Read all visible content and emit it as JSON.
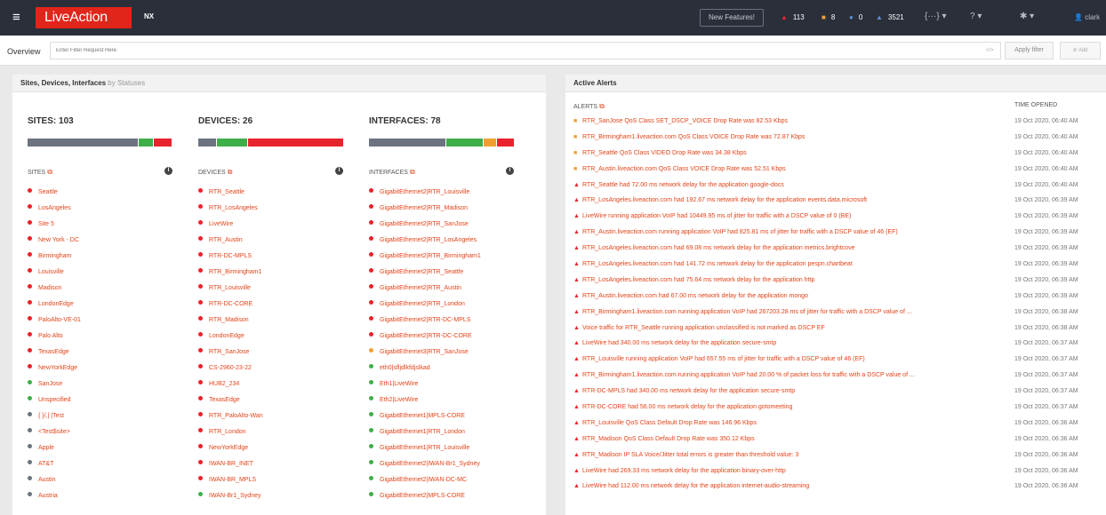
{
  "colors": {
    "topbar": "#2a2f3a",
    "brand_red": "#e2251a",
    "link_orange": "#e2441a",
    "status_red": "#e8232d",
    "status_green": "#3fae49",
    "status_gray": "#6c7380",
    "status_orange": "#f0a030"
  },
  "topbar": {
    "menu_icon": "hamburger-icon",
    "logo_text": "LiveAction",
    "product": "NX",
    "new_features": "New Features!",
    "counters": [
      {
        "icon": "triangle-icon",
        "glyph": "▲",
        "color": "#e8232d",
        "value": "113"
      },
      {
        "icon": "square-icon",
        "glyph": "■",
        "color": "#f0a030",
        "value": "8"
      },
      {
        "icon": "circle-icon",
        "glyph": "●",
        "color": "#5b8fd6",
        "value": "0"
      },
      {
        "icon": "bell-icon",
        "glyph": "🔔",
        "color": "#5b8fd6",
        "value": "3521"
      }
    ],
    "code_icon": "{···} ▾",
    "help_icon": "? ▾",
    "gear_icon": "✱ ▾",
    "user": "clark"
  },
  "filter": {
    "tab": "Overview",
    "placeholder": "Enter Filter Request Here",
    "clear": "</>",
    "apply": "Apply filter",
    "add": "Add"
  },
  "left_panel": {
    "title": "Sites, Devices, Interfaces",
    "subtitle": "by Statuses",
    "columns": [
      {
        "title": "SITES: 103",
        "header": "SITES",
        "bar": [
          {
            "status": "gray",
            "fraction": 0.76
          },
          {
            "status": "green",
            "fraction": 0.1
          },
          {
            "status": "red",
            "fraction": 0.12
          }
        ],
        "items": [
          {
            "label": "Seattle",
            "status": "red"
          },
          {
            "label": "LosAngeles",
            "status": "red"
          },
          {
            "label": "Site 5",
            "status": "red"
          },
          {
            "label": "New York - DC",
            "status": "red"
          },
          {
            "label": "Birmingham",
            "status": "red"
          },
          {
            "label": "Louisville",
            "status": "red"
          },
          {
            "label": "Madison",
            "status": "red"
          },
          {
            "label": "LondonEdge",
            "status": "red"
          },
          {
            "label": "PaloAlto-VE-01",
            "status": "red"
          },
          {
            "label": "Palo Alto",
            "status": "red"
          },
          {
            "label": "TexasEdge",
            "status": "red"
          },
          {
            "label": "NewYorkEdge",
            "status": "red"
          },
          {
            "label": "SanJose",
            "status": "green"
          },
          {
            "label": "Unspecified",
            "status": "green"
          },
          {
            "label": "{ }/,| |Test",
            "status": "gray"
          },
          {
            "label": "<Test$site>",
            "status": "gray"
          },
          {
            "label": "Apple",
            "status": "gray"
          },
          {
            "label": "AT&T",
            "status": "gray"
          },
          {
            "label": "Austin",
            "status": "gray"
          },
          {
            "label": "Austria",
            "status": "gray"
          }
        ]
      },
      {
        "title": "DEVICES: 26",
        "header": "DEVICES",
        "bar": [
          {
            "status": "gray",
            "fraction": 0.12
          },
          {
            "status": "green",
            "fraction": 0.21
          },
          {
            "status": "red",
            "fraction": 0.66
          }
        ],
        "items": [
          {
            "label": "RTR_Seattle",
            "status": "red"
          },
          {
            "label": "RTR_LosAngeles",
            "status": "red"
          },
          {
            "label": "LiveWire",
            "status": "red"
          },
          {
            "label": "RTR_Austin",
            "status": "red"
          },
          {
            "label": "RTR-DC-MPLS",
            "status": "red"
          },
          {
            "label": "RTR_Birmingham1",
            "status": "red"
          },
          {
            "label": "RTR_Louisville",
            "status": "red"
          },
          {
            "label": "RTR-DC-CORE",
            "status": "red"
          },
          {
            "label": "RTR_Madison",
            "status": "red"
          },
          {
            "label": "LondonEdge",
            "status": "red"
          },
          {
            "label": "RTR_SanJose",
            "status": "red"
          },
          {
            "label": "CS-2960-23-22",
            "status": "red"
          },
          {
            "label": "HUB2_234",
            "status": "red"
          },
          {
            "label": "TexasEdge",
            "status": "red"
          },
          {
            "label": "RTR_PaloAlto-Wan",
            "status": "red"
          },
          {
            "label": "RTR_London",
            "status": "red"
          },
          {
            "label": "NewYorkEdge",
            "status": "red"
          },
          {
            "label": "IWAN-BR_INET",
            "status": "red"
          },
          {
            "label": "IWAN-BR_MPLS",
            "status": "red"
          },
          {
            "label": "IWAN-Br1_Sydney",
            "status": "green"
          }
        ]
      },
      {
        "title": "INTERFACES: 78",
        "header": "INTERFACES",
        "bar": [
          {
            "status": "gray",
            "fraction": 0.58
          },
          {
            "status": "green",
            "fraction": 0.28
          },
          {
            "status": "orange",
            "fraction": 0.09
          },
          {
            "status": "red",
            "fraction": 0.13
          }
        ],
        "items": [
          {
            "label": "GigabitEthernet2|RTR_Louisville",
            "status": "red"
          },
          {
            "label": "GigabitEthernet2|RTR_Madison",
            "status": "red"
          },
          {
            "label": "GigabitEthernet2|RTR_SanJose",
            "status": "red"
          },
          {
            "label": "GigabitEthernet2|RTR_LosAngeles",
            "status": "red"
          },
          {
            "label": "GigabitEthernet2|RTR_Birmingham1",
            "status": "red"
          },
          {
            "label": "GigabitEthernet2|RTR_Seattle",
            "status": "red"
          },
          {
            "label": "GigabitEthernet2|RTR_Austin",
            "status": "red"
          },
          {
            "label": "GigabitEthernet2|RTR_London",
            "status": "red"
          },
          {
            "label": "GigabitEthernet2|RTR-DC-MPLS",
            "status": "red"
          },
          {
            "label": "GigabitEthernet2|RTR-DC-CORE",
            "status": "red"
          },
          {
            "label": "GigabitEthernet3|RTR_SanJose",
            "status": "orange"
          },
          {
            "label": "eth0|sfljdlkfdjslkad",
            "status": "green"
          },
          {
            "label": "Eth1|LiveWire",
            "status": "green"
          },
          {
            "label": "Eth2|LiveWire",
            "status": "green"
          },
          {
            "label": "GigabitEthernet1|MPLS-CORE",
            "status": "green"
          },
          {
            "label": "GigabitEthernet1|RTR_London",
            "status": "green"
          },
          {
            "label": "GigabitEthernet1|RTR_Louisville",
            "status": "green"
          },
          {
            "label": "GigabitEthernet2|IWAN-Br1_Sydney",
            "status": "green"
          },
          {
            "label": "GigabitEthernet2|IWAN-DC-MC",
            "status": "green"
          },
          {
            "label": "GigabitEthernet2|MPLS-CORE",
            "status": "green"
          }
        ]
      }
    ]
  },
  "right_panel": {
    "title": "Active Alerts",
    "col_alerts": "ALERTS",
    "col_time": "TIME OPENED",
    "alerts": [
      {
        "severity": "major",
        "text": "RTR_SanJose QoS Class SET_DSCP_VOICE Drop Rate was 82.53 Kbps",
        "time": "19 Oct 2020, 06:40 AM"
      },
      {
        "severity": "major",
        "text": "RTR_Birmingham1.liveaction.com QoS Class VOICE Drop Rate was 72.87 Kbps",
        "time": "19 Oct 2020, 06:40 AM"
      },
      {
        "severity": "major",
        "text": "RTR_Seattle QoS Class VIDEO Drop Rate was 34.38 Kbps",
        "time": "19 Oct 2020, 06:40 AM"
      },
      {
        "severity": "major",
        "text": "RTR_Austin.liveaction.com QoS Class VOICE Drop Rate was 52.51 Kbps",
        "time": "19 Oct 2020, 06:40 AM"
      },
      {
        "severity": "critical",
        "text": "RTR_Seattle had 72.00 ms network delay for the application google-docs",
        "time": "19 Oct 2020, 06:40 AM"
      },
      {
        "severity": "critical",
        "text": "RTR_LosAngeles.liveaction.com had 192.67 ms network delay for the application events.data.microsoft",
        "time": "19 Oct 2020, 06:39 AM"
      },
      {
        "severity": "critical",
        "text": "LiveWire running application VoIP had 10449.95 ms of jitter for traffic with a DSCP value of 0 (BE)",
        "time": "19 Oct 2020, 06:39 AM"
      },
      {
        "severity": "critical",
        "text": "RTR_Austin.liveaction.com running application VoIP had 825.81 ms of jitter for traffic with a DSCP value of 46 (EF)",
        "time": "19 Oct 2020, 06:39 AM"
      },
      {
        "severity": "critical",
        "text": "RTR_LosAngeles.liveaction.com had 69.08 ms network delay for the application metrics.brightcove",
        "time": "19 Oct 2020, 06:39 AM"
      },
      {
        "severity": "critical",
        "text": "RTR_LosAngeles.liveaction.com had 141.72 ms network delay for the application pespn.chartbeat",
        "time": "19 Oct 2020, 06:39 AM"
      },
      {
        "severity": "critical",
        "text": "RTR_LosAngeles.liveaction.com had 75.64 ms network delay for the application http",
        "time": "19 Oct 2020, 06:39 AM"
      },
      {
        "severity": "critical",
        "text": "RTR_Austin.liveaction.com had 67.00 ms network delay for the application mongo",
        "time": "19 Oct 2020, 06:39 AM"
      },
      {
        "severity": "critical",
        "text": "RTR_Birmingham1.liveaction.com running application VoIP had 267203.28 ms of jitter for traffic with a DSCP value of ...",
        "time": "19 Oct 2020, 06:38 AM"
      },
      {
        "severity": "critical",
        "text": "Voice traffic for RTR_Seattle running application unclassified is not marked as DSCP EF",
        "time": "19 Oct 2020, 06:38 AM"
      },
      {
        "severity": "critical",
        "text": "LiveWire had 340.00 ms network delay for the application secure-smtp",
        "time": "19 Oct 2020, 06:37 AM"
      },
      {
        "severity": "critical",
        "text": "RTR_Louisville running application VoIP had 657.55 ms of jitter for traffic with a DSCP value of 46 (EF)",
        "time": "19 Oct 2020, 06:37 AM"
      },
      {
        "severity": "critical",
        "text": "RTR_Birmingham1.liveaction.com running application VoIP had 20.00 % of packet loss for traffic with a DSCP value of ...",
        "time": "19 Oct 2020, 06:37 AM"
      },
      {
        "severity": "critical",
        "text": "RTR-DC-MPLS had 340.00 ms network delay for the application secure-smtp",
        "time": "19 Oct 2020, 06:37 AM"
      },
      {
        "severity": "critical",
        "text": "RTR-DC-CORE had 56.00 ms network delay for the application gotomeeting",
        "time": "19 Oct 2020, 06:37 AM"
      },
      {
        "severity": "critical",
        "text": "RTR_Louisville QoS Class Default Drop Rate was 146.96 Kbps",
        "time": "19 Oct 2020, 06:36 AM"
      },
      {
        "severity": "critical",
        "text": "RTR_Madison QoS Class Default Drop Rate was 350.12 Kbps",
        "time": "19 Oct 2020, 06:36 AM"
      },
      {
        "severity": "critical",
        "text": "RTR_Madison IP SLA Voice/Jitter total errors is greater than threshold value: 3",
        "time": "19 Oct 2020, 06:36 AM"
      },
      {
        "severity": "critical",
        "text": "LiveWire had 269.33 ms network delay for the application binary-over-http",
        "time": "19 Oct 2020, 06:36 AM"
      },
      {
        "severity": "critical",
        "text": "LiveWire had 112.00 ms network delay for the application internet-audio-streaming",
        "time": "19 Oct 2020, 06:36 AM"
      }
    ]
  }
}
